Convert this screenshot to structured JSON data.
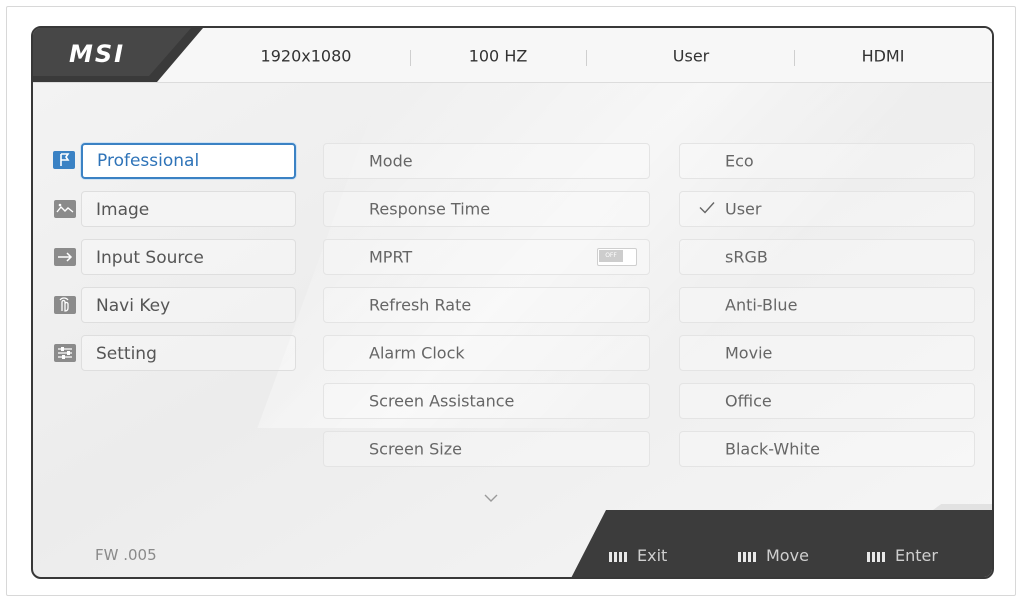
{
  "brand": {
    "logo": "MSI"
  },
  "status_bar": {
    "resolution": "1920x1080",
    "refresh": "100 HZ",
    "mode": "User",
    "input": "HDMI"
  },
  "nav": {
    "items": [
      {
        "label": "Professional",
        "icon": "flag-icon",
        "selected": true
      },
      {
        "label": "Image",
        "icon": "image-icon"
      },
      {
        "label": "Input Source",
        "icon": "arrow-right-icon"
      },
      {
        "label": "Navi Key",
        "icon": "hand-icon"
      },
      {
        "label": "Setting",
        "icon": "sliders-icon"
      }
    ]
  },
  "options": {
    "items": [
      {
        "label": "Mode"
      },
      {
        "label": "Response Time"
      },
      {
        "label": "MPRT",
        "toggle": "OFF"
      },
      {
        "label": "Refresh Rate"
      },
      {
        "label": "Alarm Clock"
      },
      {
        "label": "Screen Assistance"
      },
      {
        "label": "Screen Size"
      }
    ]
  },
  "modes": {
    "items": [
      {
        "label": "Eco"
      },
      {
        "label": "User",
        "checked": true
      },
      {
        "label": "sRGB"
      },
      {
        "label": "Anti-Blue"
      },
      {
        "label": "Movie"
      },
      {
        "label": "Office"
      },
      {
        "label": "Black-White"
      }
    ]
  },
  "footer": {
    "firmware": "FW .005",
    "exit": "Exit",
    "move": "Move",
    "enter": "Enter"
  },
  "colors": {
    "accent": "#3b82c4",
    "frame": "#383838",
    "background": "#efefef"
  }
}
